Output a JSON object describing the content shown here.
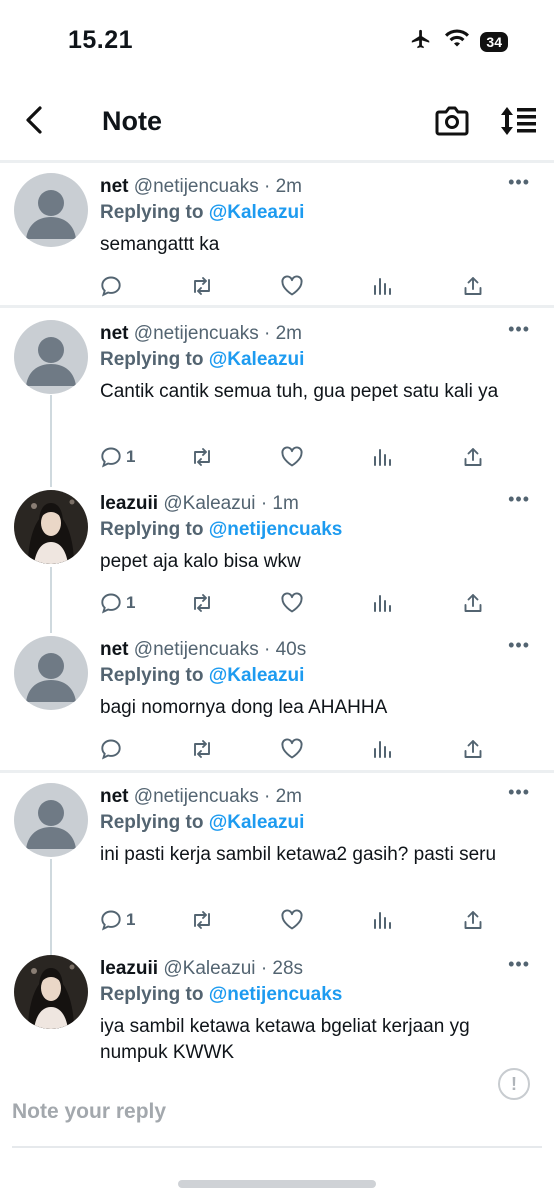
{
  "status": {
    "time": "15.21",
    "battery": "34"
  },
  "nav": {
    "title": "Note"
  },
  "tweets": [
    {
      "name": "net",
      "handle": "@netijencuaks",
      "time": "2m",
      "replying_label": "Replying to",
      "mention": "@Kaleazui",
      "text": "semangattt ka",
      "reply_count": ""
    },
    {
      "name": "net",
      "handle": "@netijencuaks",
      "time": "2m",
      "replying_label": "Replying to",
      "mention": "@Kaleazui",
      "text": "Cantik cantik semua tuh, gua pepet satu kali ya",
      "reply_count": "1"
    },
    {
      "name": "leazuii",
      "handle": "@Kaleazui",
      "time": "1m",
      "replying_label": "Replying to",
      "mention": "@netijencuaks",
      "text": "pepet aja kalo bisa wkw",
      "reply_count": "1"
    },
    {
      "name": "net",
      "handle": "@netijencuaks",
      "time": "40s",
      "replying_label": "Replying to",
      "mention": "@Kaleazui",
      "text": "bagi nomornya dong lea AHAHHA",
      "reply_count": ""
    },
    {
      "name": "net",
      "handle": "@netijencuaks",
      "time": "2m",
      "replying_label": "Replying to",
      "mention": "@Kaleazui",
      "text": "ini pasti kerja sambil ketawa2 gasih? pasti seru",
      "reply_count": "1"
    },
    {
      "name": "leazuii",
      "handle": "@Kaleazui",
      "time": "28s",
      "replying_label": "Replying to",
      "mention": "@netijencuaks",
      "text": "iya sambil ketawa ketawa bgeliat kerjaan yg numpuk KWWK",
      "reply_count": ""
    }
  ],
  "more_label": "•••",
  "composer": {
    "placeholder": "Note your reply",
    "alert_label": "!"
  },
  "icons": {
    "back": "chevron-left-icon",
    "camera": "camera-icon",
    "sort": "sort-icon",
    "reply": "reply-icon",
    "retweet": "retweet-icon",
    "like": "heart-icon",
    "views": "views-icon",
    "share": "share-icon"
  },
  "colors": {
    "mention": "#1d9bf0",
    "muted": "#536471",
    "divider": "#eceff1"
  }
}
